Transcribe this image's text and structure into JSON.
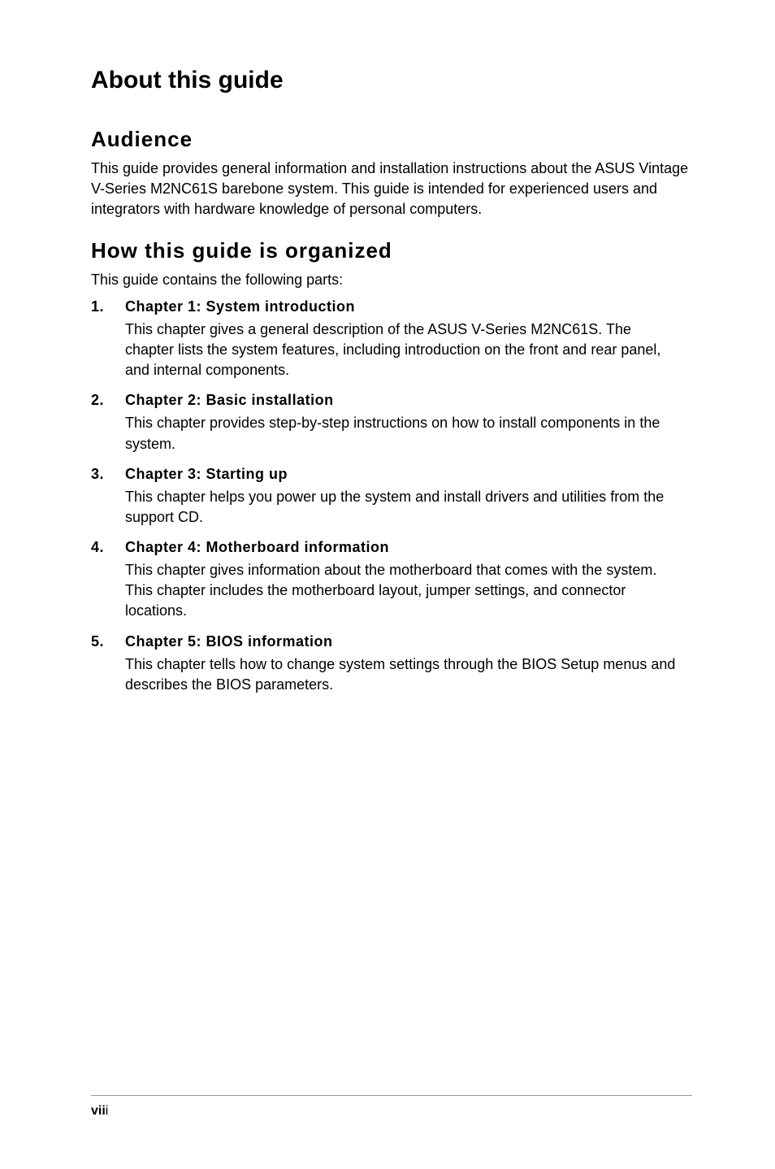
{
  "title": "About this guide",
  "sections": {
    "audience": {
      "heading": "Audience",
      "body": "This guide provides general information and installation instructions about the ASUS Vintage V-Series M2NC61S barebone system. This guide is intended for experienced users and integrators with hardware knowledge of personal computers."
    },
    "organized": {
      "heading": "How this guide is organized",
      "intro": "This guide contains the following parts:",
      "chapters": [
        {
          "num": "1.",
          "title": "Chapter 1: System introduction",
          "desc": "This chapter gives a general description of the ASUS V-Series M2NC61S. The chapter lists the system features, including introduction on the front and rear panel, and internal components."
        },
        {
          "num": "2.",
          "title": "Chapter 2: Basic installation",
          "desc": "This chapter provides step-by-step instructions on how to install components in the system."
        },
        {
          "num": "3.",
          "title": "Chapter 3: Starting up",
          "desc": "This chapter helps you power up the system and install drivers and utilities from the support CD."
        },
        {
          "num": "4.",
          "title": "Chapter 4: Motherboard information",
          "desc": "This chapter gives information about the motherboard that comes with the system. This chapter includes the motherboard layout, jumper settings, and connector locations."
        },
        {
          "num": "5.",
          "title": "Chapter 5: BIOS information",
          "desc": "This chapter tells how to change system settings through the BIOS Setup menus and describes the BIOS parameters."
        }
      ]
    }
  },
  "footer": {
    "page_bold": "vii",
    "page_rest": "i"
  }
}
